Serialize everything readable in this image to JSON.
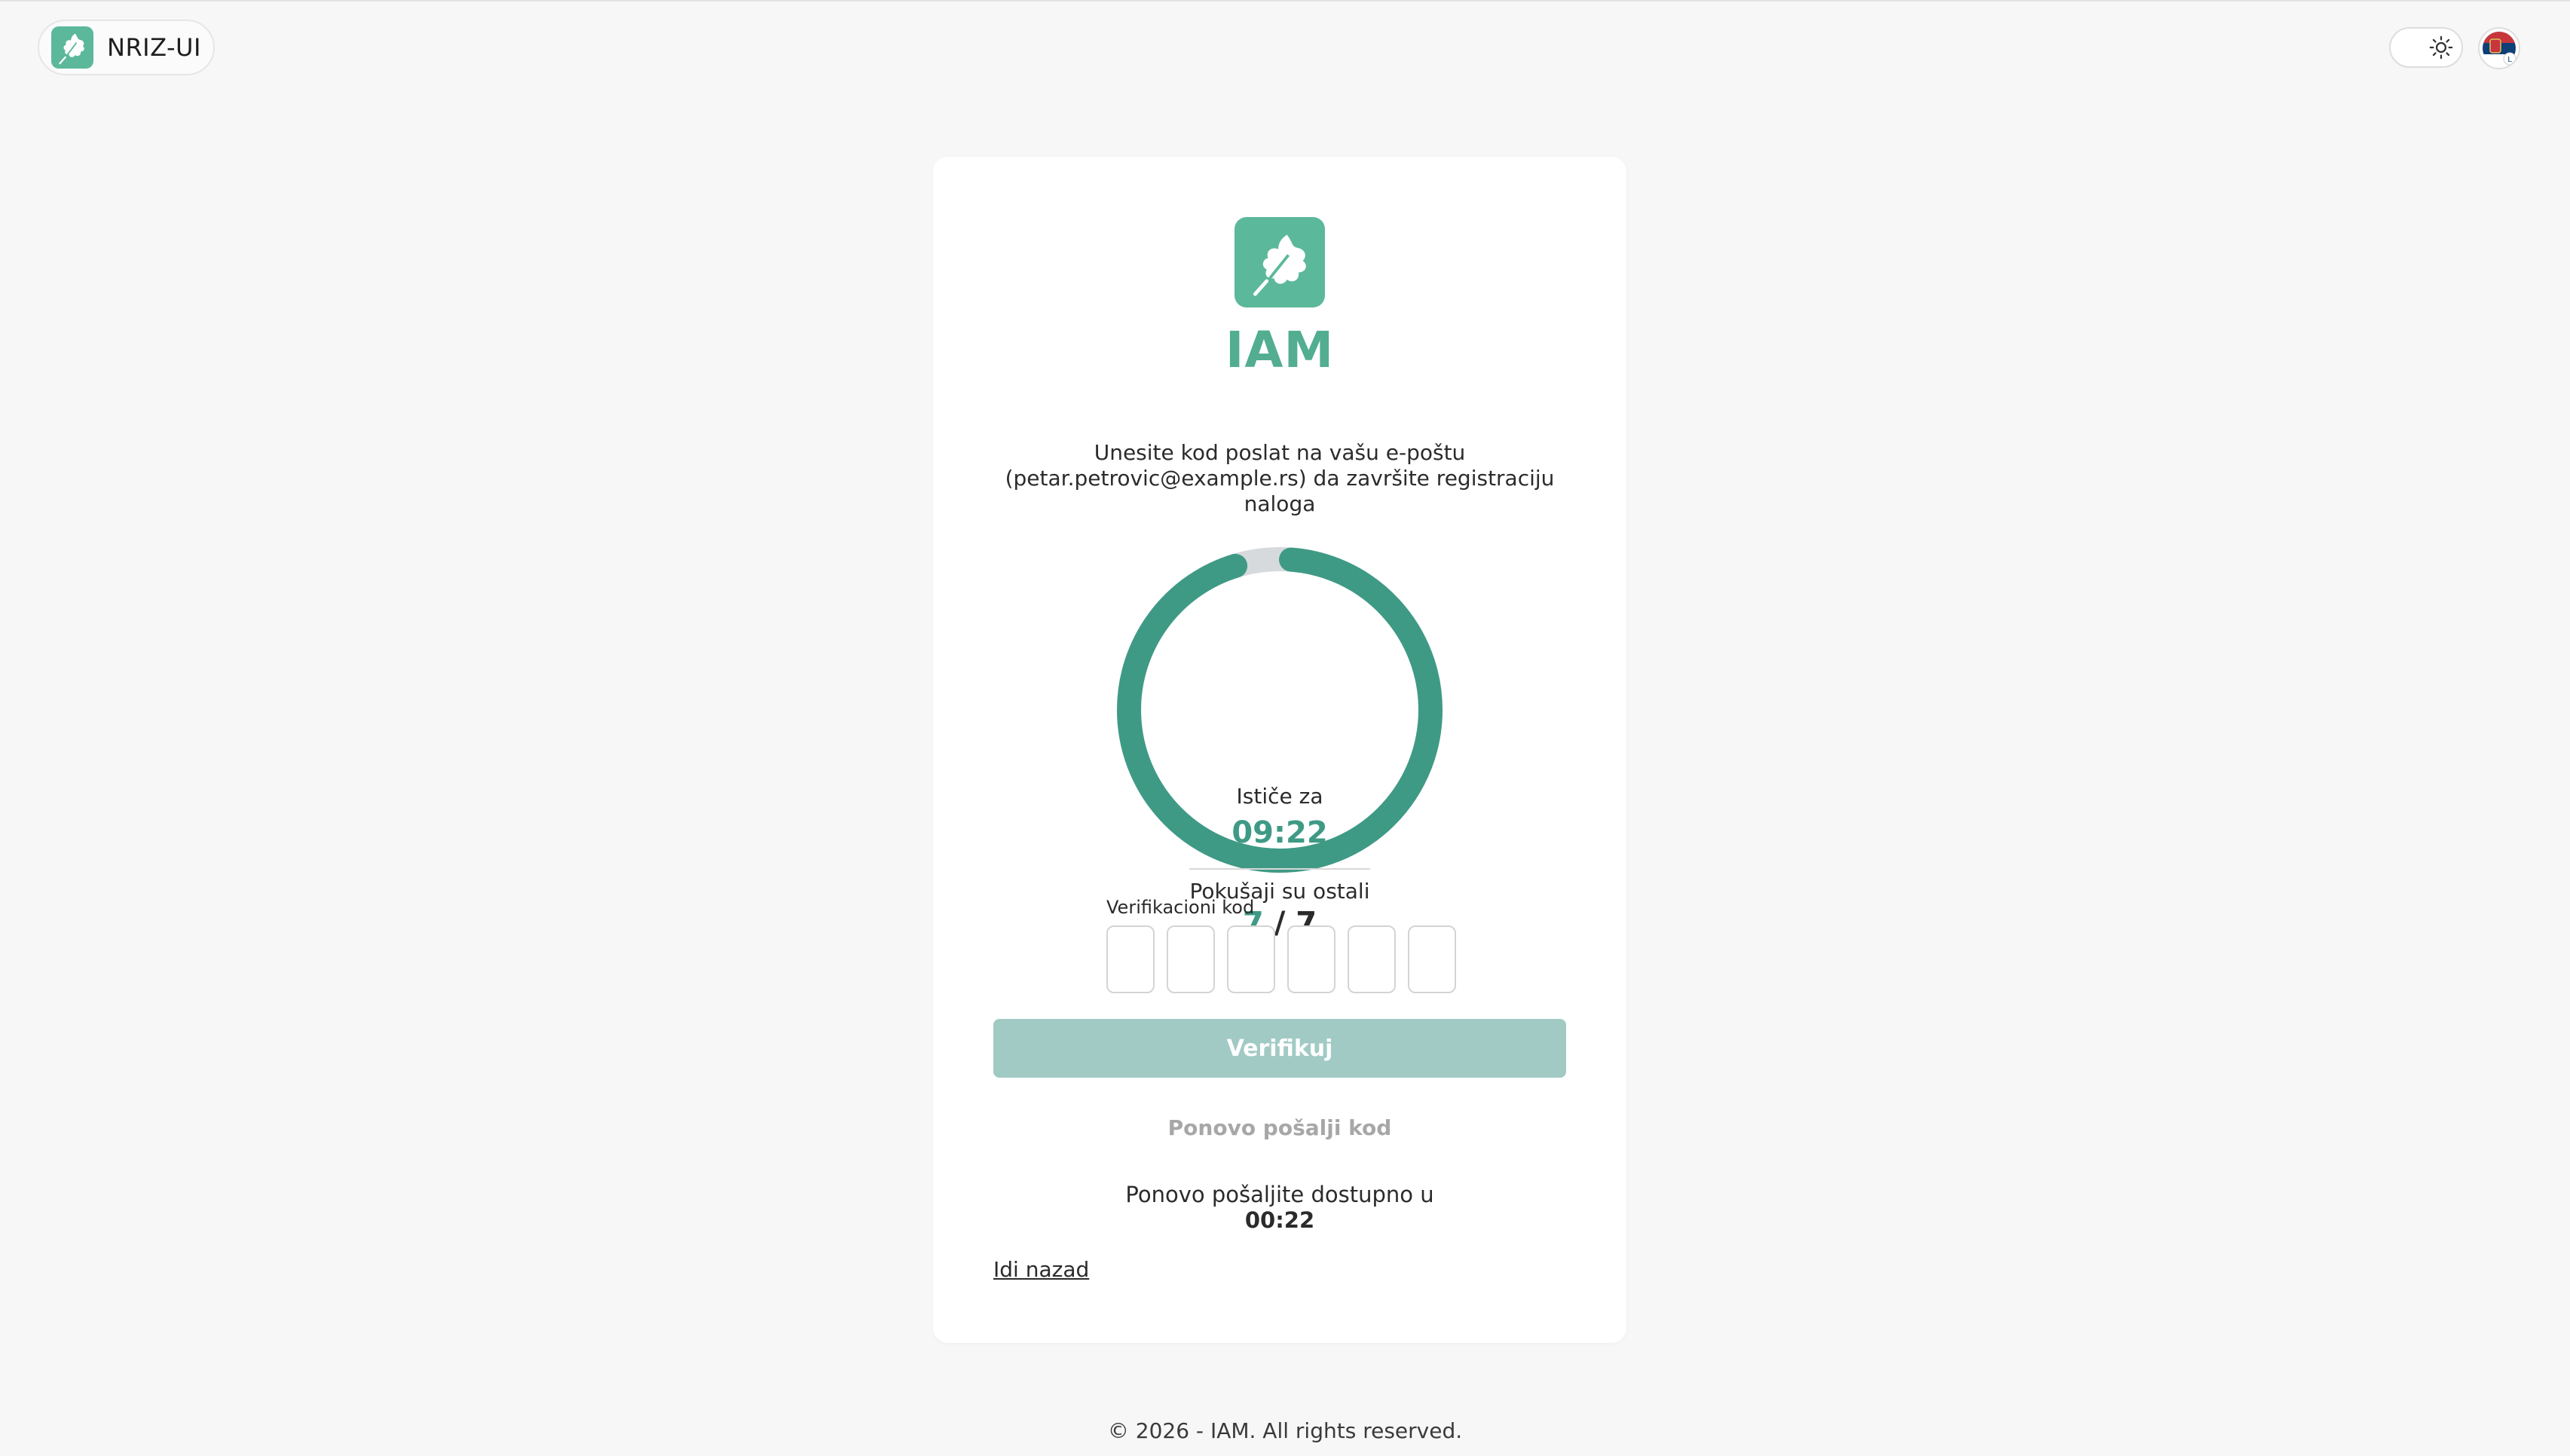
{
  "header": {
    "brand_name": "NRIZ-UI",
    "brand_icon": "oak-leaf-icon",
    "theme_icon": "sun-icon",
    "language_icon": "serbian-flag-icon"
  },
  "card": {
    "app_title": "IAM",
    "instruction": "Unesite kod poslat na vašu e-poštu (petar.petrovic@example.rs) da završite registraciju naloga",
    "timer": {
      "expires_label": "Ističe za",
      "expires_time": "09:22",
      "remaining_fraction": 0.94,
      "attempts_label": "Pokušaji su ostali",
      "attempts_left": "7",
      "attempts_separator": " / ",
      "attempts_total": "7"
    },
    "code": {
      "label": "Verifikacioni kod",
      "digits": [
        "",
        "",
        "",
        "",
        "",
        ""
      ]
    },
    "verify_label": "Verifikuj",
    "resend_label": "Ponovo pošalji kod",
    "resend_info_text": "Ponovo pošaljite dostupno u",
    "resend_info_time": "00:22",
    "back_label": "Idi nazad"
  },
  "footer": {
    "text": "© 2026 - IAM. All rights reserved."
  },
  "colors": {
    "accent": "#52ad91",
    "ring": "#3e9a85",
    "ring_track": "#d6dadd",
    "button_disabled": "#a1cac4",
    "background": "#f7f7f7"
  }
}
